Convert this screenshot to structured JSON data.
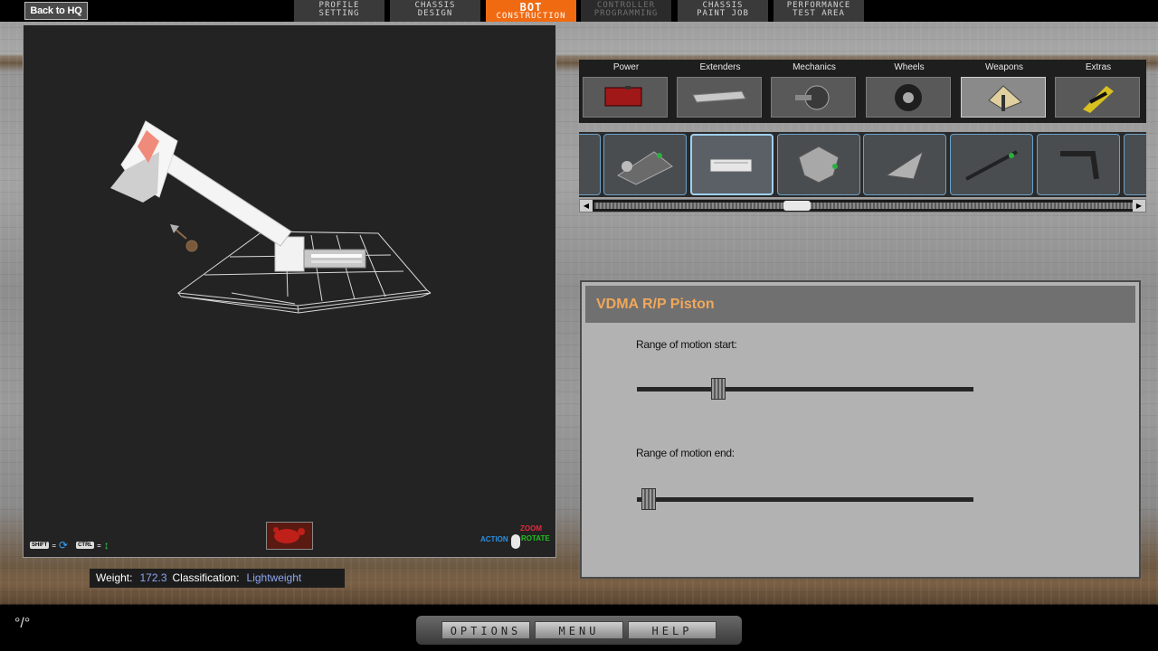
{
  "header": {
    "back_label": "Back to HQ",
    "tabs": [
      {
        "line1": "PROFILE",
        "line2": "SETTING"
      },
      {
        "line1": "CHASSIS",
        "line2": "DESIGN"
      },
      {
        "line1": "BOT",
        "line2": "CONSTRUCTION"
      },
      {
        "line1": "CONTROLLER",
        "line2": "PROGRAMMING"
      },
      {
        "line1": "CHASSIS",
        "line2": "PAINT JOB"
      },
      {
        "line1": "PERFORMANCE",
        "line2": "TEST AREA"
      }
    ],
    "active_tab": "BOT CONSTRUCTION"
  },
  "viewport": {
    "hint_shift_key": "SHIFT",
    "hint_ctrl_key": "CTRL",
    "legend": {
      "zoom": "ZOOM",
      "action": "ACTION",
      "rotate": "ROTATE"
    }
  },
  "stats": {
    "weight_label": "Weight:",
    "weight_value": "172.3",
    "class_label": "Classification:",
    "class_value": "Lightweight"
  },
  "parts": {
    "categories": [
      "Power",
      "Extenders",
      "Mechanics",
      "Wheels",
      "Weapons",
      "Extras"
    ],
    "active_category": "Weapons",
    "items": [
      "weapon-kit",
      "piston",
      "axe-head",
      "spike-blade",
      "spear",
      "hook-arm"
    ],
    "selected_item": 1,
    "scroll_position": 0.37
  },
  "piston": {
    "title": "VDMA R/P Piston",
    "start_label": "Range of motion start:",
    "end_label": "Range of motion end:",
    "start_value": 0.22,
    "end_value": 0.02
  },
  "menu": {
    "options": "OPTIONS",
    "menu": "MENU",
    "help": "HELP"
  }
}
